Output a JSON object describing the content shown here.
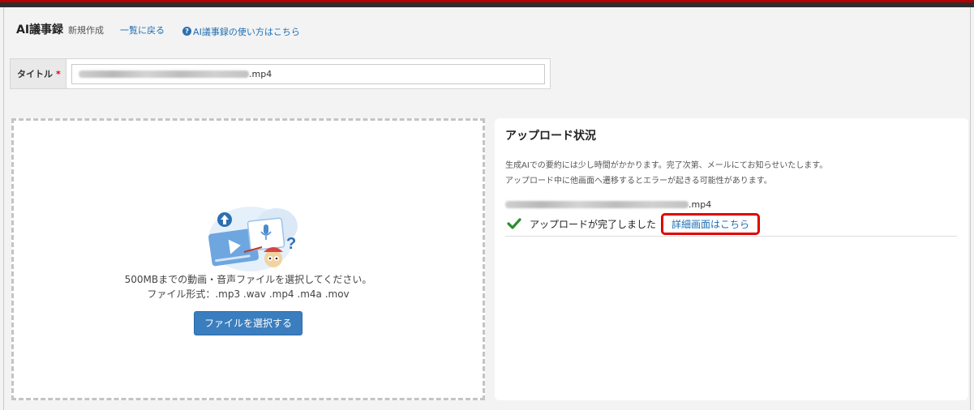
{
  "header": {
    "app_title": "AI議事録",
    "mode_label": "新規作成",
    "back_link": "一覧に戻る",
    "help_link": "AI議事録の使い方はこちら"
  },
  "form": {
    "title_label": "タイトル",
    "required_mark": "*",
    "title_value_suffix": ".mp4"
  },
  "dropzone": {
    "instruction": "500MBまでの動画・音声ファイルを選択してください。",
    "formats": "ファイル形式：.mp3 .wav .mp4 .m4a .mov",
    "select_button": "ファイルを選択する"
  },
  "status": {
    "title": "アップロード状況",
    "note_1": "生成AIでの要約には少し時間がかかります。完了次第、メールにてお知らせいたします。",
    "note_2": "アップロード中に他画面へ遷移するとエラーが起きる可能性があります。",
    "file_name_suffix": ".mp4",
    "complete_message": "アップロードが完了しました",
    "detail_link": "詳細画面はこちら"
  },
  "colors": {
    "accent_red": "#b40000",
    "link_blue": "#1e6fb5",
    "button_blue": "#3a7ebf",
    "check_green": "#2e8b2e",
    "highlight_red": "#e10000"
  },
  "icons": {
    "help": "question-circle-icon",
    "done": "check-icon",
    "upload_illustration": "video-audio-upload-illustration"
  }
}
